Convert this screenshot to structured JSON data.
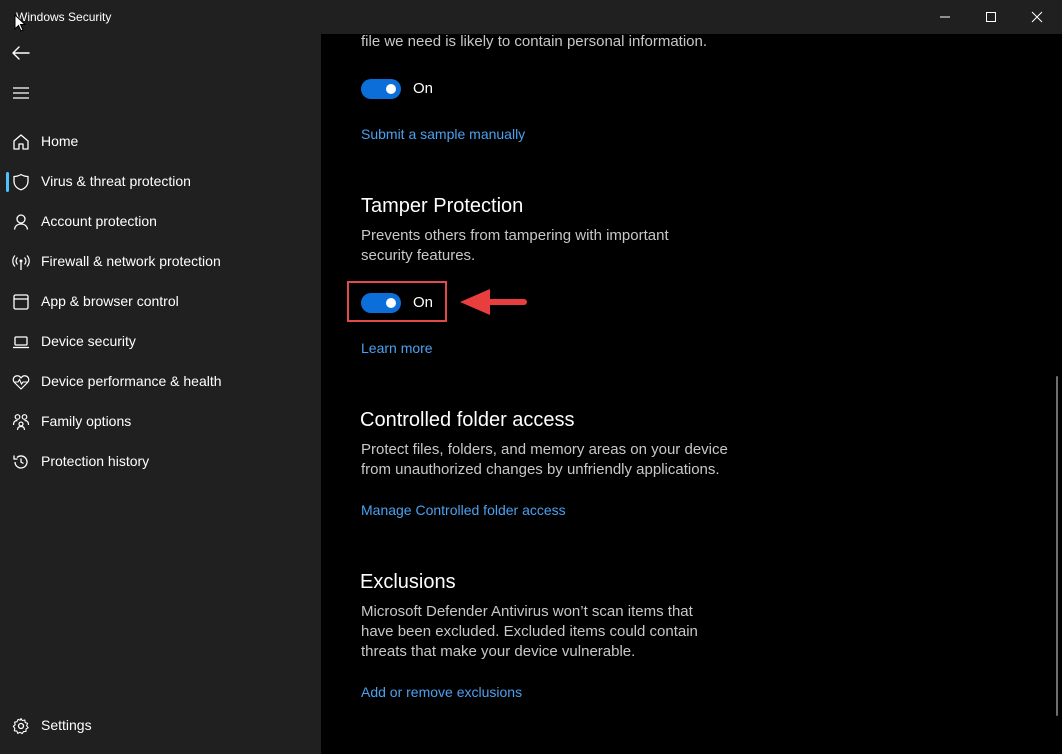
{
  "window": {
    "title": "Windows Security",
    "controls": [
      "minimize",
      "maximize",
      "close"
    ]
  },
  "sidebar": {
    "items": [
      {
        "label": "Home",
        "icon": "home-icon"
      },
      {
        "label": "Virus & threat protection",
        "icon": "shield-icon",
        "active": true
      },
      {
        "label": "Account protection",
        "icon": "person-icon"
      },
      {
        "label": "Firewall & network protection",
        "icon": "antenna-icon"
      },
      {
        "label": "App & browser control",
        "icon": "app-window-icon"
      },
      {
        "label": "Device security",
        "icon": "laptop-icon"
      },
      {
        "label": "Device performance & health",
        "icon": "heart-pulse-icon"
      },
      {
        "label": "Family options",
        "icon": "family-icon"
      },
      {
        "label": "Protection history",
        "icon": "history-icon"
      }
    ],
    "settings": {
      "label": "Settings",
      "icon": "gear-icon"
    }
  },
  "main": {
    "top_text": "file we need is likely to contain personal information.",
    "sample_toggle": {
      "label": "On",
      "state": true
    },
    "submit_link": "Submit a sample manually",
    "tamper": {
      "heading": "Tamper Protection",
      "desc_line1": "Prevents others from tampering with important",
      "desc_line2": "security features.",
      "toggle": {
        "label": "On",
        "state": true
      },
      "link": "Learn more"
    },
    "cfa": {
      "heading": "Controlled folder access",
      "desc_line1": "Protect files, folders, and memory areas on your device",
      "desc_line2": "from unauthorized changes by unfriendly applications.",
      "link": "Manage Controlled folder access"
    },
    "exclusions": {
      "heading": "Exclusions",
      "desc_line1": "Microsoft Defender Antivirus won’t scan items that",
      "desc_line2": "have been excluded. Excluded items could contain",
      "desc_line3": "threats that make your device vulnerable.",
      "link": "Add or remove exclusions"
    }
  },
  "colors": {
    "accent": "#0c6ed9",
    "link": "#4ca0f0",
    "annotation": "#e04a4a",
    "sidebar_bg": "#202020",
    "main_bg": "#000000"
  }
}
